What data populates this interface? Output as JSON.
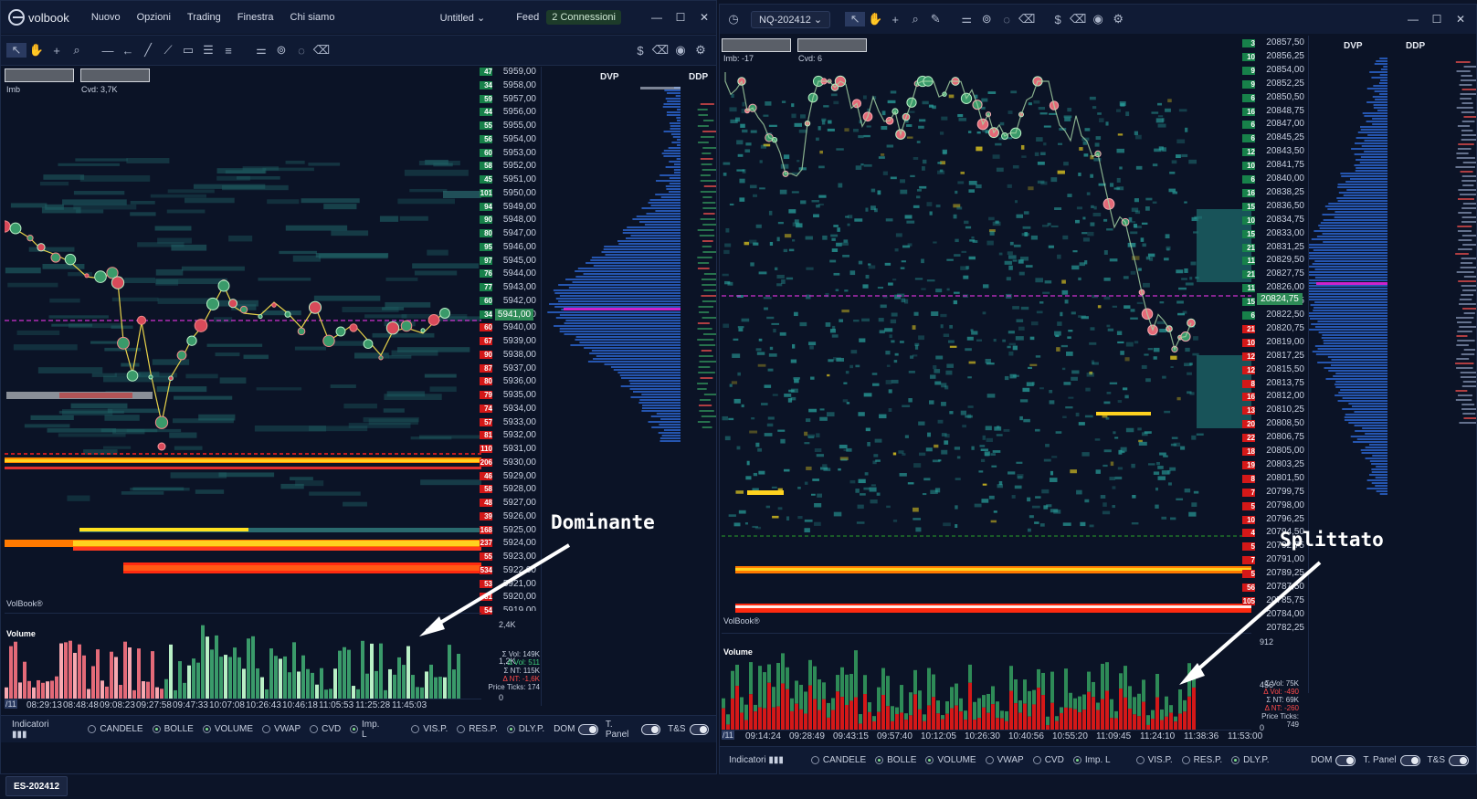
{
  "app": {
    "logo_text": "volbook"
  },
  "menu": {
    "items": [
      "Nuovo",
      "Opzioni",
      "Trading",
      "Finestra",
      "Chi siamo"
    ]
  },
  "left_window": {
    "layout_name": "Untitled",
    "feed_label": "Feed",
    "connections_label": "2 Connessioni",
    "symbol": "ES-202412",
    "imb_label": "Imb",
    "cvd_label": "Cvd: 3,7K",
    "watermark": "VolBook®",
    "volume_panel_title": "Volume",
    "dvp_label": "DVP",
    "ddp_label": "DDP",
    "current_price": "5941,00",
    "price_labels": [
      "5959,00",
      "5958,00",
      "5957,00",
      "5956,00",
      "5955,00",
      "5954,00",
      "5953,00",
      "5952,00",
      "5951,00",
      "5950,00",
      "5949,00",
      "5948,00",
      "5947,00",
      "5946,00",
      "5945,00",
      "5944,00",
      "5943,00",
      "5942,00",
      "5941,00",
      "5940,00",
      "5939,00",
      "5938,00",
      "5937,00",
      "5936,00",
      "5935,00",
      "5934,00",
      "5933,00",
      "5932,00",
      "5931,00",
      "5930,00",
      "5929,00",
      "5928,00",
      "5927,00",
      "5926,00",
      "5925,00",
      "5924,00",
      "5923,00",
      "5922,00",
      "5921,00",
      "5920,00",
      "5919,00"
    ],
    "side_volumes": [
      "47",
      "34",
      "59",
      "44",
      "55",
      "56",
      "60",
      "58",
      "45",
      "101",
      "94",
      "90",
      "80",
      "95",
      "97",
      "76",
      "77",
      "60",
      "34",
      "60",
      "67",
      "90",
      "87",
      "80",
      "79",
      "74",
      "57",
      "81",
      "110",
      "206",
      "46",
      "58",
      "48",
      "39",
      "168",
      "237",
      "55",
      "534",
      "53",
      "81",
      "54"
    ],
    "volume_axis_top": "2,4K",
    "volume_axis_mid": "1,2K",
    "volume_axis_zero": "0",
    "stats": {
      "sum_vol": "Σ Vol: 149K",
      "delta_vol": "Δ Vol: 511",
      "sum_nt": "Σ NT: 115K",
      "delta_nt": "Δ NT: -1,6K",
      "price_ticks": "Price Ticks: 174"
    },
    "time_labels": [
      "08:29:13",
      "08:48:48",
      "09:08:23",
      "09:27:58",
      "09:47:33",
      "10:07:08",
      "10:26:43",
      "10:46:18",
      "11:05:53",
      "11:25:28",
      "11:45:03"
    ],
    "date_tag": "/11",
    "annotation": "Dominante"
  },
  "right_window": {
    "symbol": "NQ-202412",
    "imb_label": "Imb: -17",
    "cvd_label": "Cvd: 6",
    "watermark": "VolBook®",
    "volume_panel_title": "Volume",
    "dvp_label": "DVP",
    "ddp_label": "DDP",
    "current_price": "20824,75",
    "price_labels": [
      "20857,50",
      "20856,25",
      "20854,00",
      "20852,25",
      "20850,50",
      "20848,75",
      "20847,00",
      "20845,25",
      "20843,50",
      "20841,75",
      "20840,00",
      "20838,25",
      "20836,50",
      "20834,75",
      "20833,00",
      "20831,25",
      "20829,50",
      "20827,75",
      "20826,00",
      "20824,25",
      "20822,50",
      "20820,75",
      "20819,00",
      "20817,25",
      "20815,50",
      "20813,75",
      "20812,00",
      "20810,25",
      "20808,50",
      "20806,75",
      "20805,00",
      "20803,25",
      "20801,50",
      "20799,75",
      "20798,00",
      "20796,25",
      "20794,50",
      "20792,75",
      "20791,00",
      "20789,25",
      "20787,50",
      "20785,75",
      "20784,00",
      "20782,25"
    ],
    "side_volumes": [
      "3",
      "10",
      "9",
      "9",
      "6",
      "16",
      "6",
      "6",
      "12",
      "10",
      "6",
      "16",
      "15",
      "10",
      "15",
      "21",
      "11",
      "21",
      "11",
      "15",
      "6",
      "21",
      "10",
      "12",
      "12",
      "8",
      "16",
      "13",
      "20",
      "22",
      "18",
      "19",
      "8",
      "7",
      "5",
      "10",
      "4",
      "5",
      "7",
      "5",
      "56",
      "105"
    ],
    "volume_axis_top": "912",
    "volume_axis_mid": "456",
    "volume_axis_zero": "0",
    "stats": {
      "sum_vol": "Σ Vol: 75K",
      "delta_vol": "Δ Vol: -490",
      "sum_nt": "Σ NT: 69K",
      "delta_nt": "Δ NT: -260",
      "price_ticks": "Price Ticks: 749"
    },
    "time_labels": [
      "09:14:24",
      "09:28:49",
      "09:43:15",
      "09:57:40",
      "10:12:05",
      "10:26:30",
      "10:40:56",
      "10:55:20",
      "11:09:45",
      "11:24:10",
      "11:38:36",
      "11:53:00"
    ],
    "date_tag": "/11",
    "annotation": "Splittato"
  },
  "bottom_bar": {
    "indicators_label": "Indicatori",
    "options": [
      {
        "label": "CANDELE",
        "on": false
      },
      {
        "label": "BOLLE",
        "on": true
      },
      {
        "label": "VOLUME",
        "on": true
      },
      {
        "label": "VWAP",
        "on": false
      },
      {
        "label": "CVD",
        "on": false
      },
      {
        "label": "Imp. L",
        "on": true
      }
    ],
    "profile_options": [
      {
        "label": "VIS.P.",
        "on": false
      },
      {
        "label": "RES.P.",
        "on": false
      },
      {
        "label": "DLY.P.",
        "on": true
      }
    ],
    "toggles": [
      "DOM",
      "T. Panel",
      "T&S"
    ]
  },
  "colors": {
    "accent_green": "#2e8b57",
    "ask_red": "#e02020",
    "dvp_blue": "#2a62c8",
    "poc_magenta": "#cc22cc",
    "bg": "#0b1326"
  }
}
